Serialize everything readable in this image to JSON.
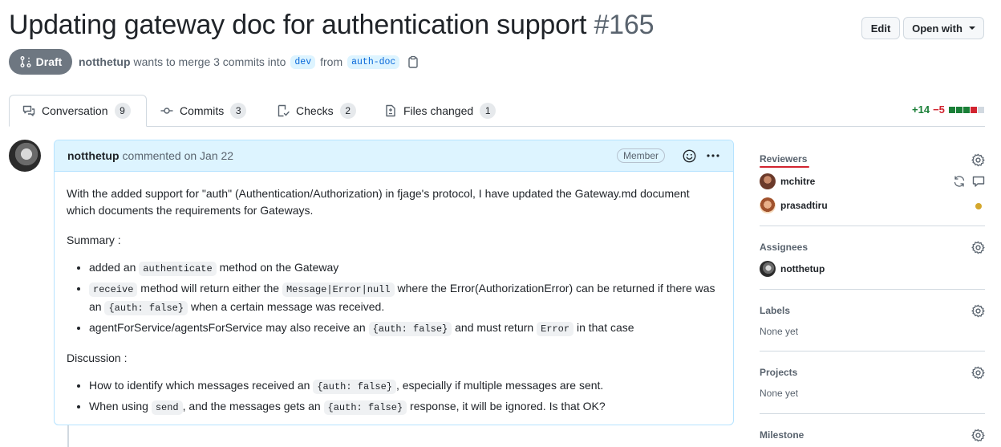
{
  "header": {
    "title": "Updating gateway doc for authentication support",
    "number": "#165",
    "edit_label": "Edit",
    "open_with_label": "Open with"
  },
  "meta": {
    "status": "Draft",
    "author": "notthetup",
    "text_merge": "wants to merge 3 commits into",
    "base_branch": "dev",
    "text_from": "from",
    "head_branch": "auth-doc"
  },
  "tabs": [
    {
      "label": "Conversation",
      "count": "9"
    },
    {
      "label": "Commits",
      "count": "3"
    },
    {
      "label": "Checks",
      "count": "2"
    },
    {
      "label": "Files changed",
      "count": "1"
    }
  ],
  "diffstat": {
    "additions": "+14",
    "deletions": "−5"
  },
  "comment": {
    "author": "notthetup",
    "action": "commented on Jan 22",
    "badge": "Member",
    "p1": "With the added support for \"auth\" (Authentication/Authorization) in fjage's protocol, I have updated the Gateway.md document which documents the requirements for Gateways.",
    "summary_heading": "Summary :",
    "s1_a": "added an ",
    "s1_code": "authenticate",
    "s1_b": " method on the Gateway",
    "s2_code1": "receive",
    "s2_a": " method will return either the ",
    "s2_code2": "Message|Error|null",
    "s2_b": " where the Error(AuthorizationError) can be returned if there was an ",
    "s2_code3": "{auth: false}",
    "s2_c": " when a certain message was received.",
    "s3_a": "agentForService/agentsForService may also receive an ",
    "s3_code1": "{auth: false}",
    "s3_b": " and must return ",
    "s3_code2": "Error",
    "s3_c": " in that case",
    "discussion_heading": "Discussion :",
    "d1_a": "How to identify which messages received an ",
    "d1_code": "{auth: false}",
    "d1_b": ", especially if multiple messages are sent.",
    "d2_a": "When using ",
    "d2_code1": "send",
    "d2_b": ", and the messages gets an ",
    "d2_code2": "{auth: false}",
    "d2_c": " response, it will be ignored. Is that OK?"
  },
  "sidebar": {
    "reviewers_title": "Reviewers",
    "reviewers": [
      {
        "name": "mchitre"
      },
      {
        "name": "prasadtiru"
      }
    ],
    "assignees_title": "Assignees",
    "assignee": "notthetup",
    "labels_title": "Labels",
    "labels_value": "None yet",
    "projects_title": "Projects",
    "projects_value": "None yet",
    "milestone_title": "Milestone"
  },
  "colors": {
    "draft": "#6e7781",
    "accent_blue": "#0969da",
    "additions": "#1a7f37",
    "deletions": "#d1242f",
    "pending_dot": "#d4a72c"
  },
  "icons": {
    "draft": "git-pull-request-draft-icon",
    "copy": "copy-icon",
    "conversation": "comment-discussion-icon",
    "commits": "git-commit-icon",
    "checks": "checklist-icon",
    "files": "file-diff-icon",
    "emoji": "smiley-icon",
    "more": "kebab-horizontal-icon",
    "gear": "gear-icon",
    "sync": "sync-icon",
    "comment": "comment-icon"
  }
}
